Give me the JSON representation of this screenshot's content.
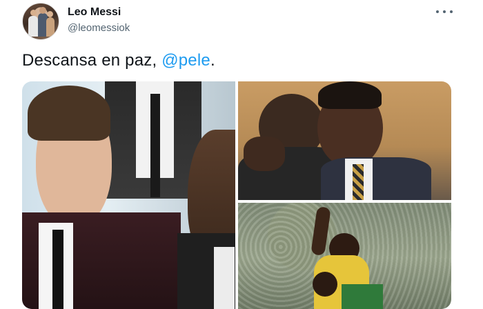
{
  "tweet": {
    "author_name": "Leo Messi",
    "author_handle": "@leomessiok",
    "text_prefix": "Descansa en paz, ",
    "mention": "@pele",
    "text_suffix": ".",
    "mention_color": "#1d9bf0"
  },
  "icons": {
    "more": "more-options-icon"
  },
  "media": {
    "count": 3,
    "images": [
      {
        "id": "left",
        "subject": "photo-messi-pele-suits"
      },
      {
        "id": "top-right",
        "subject": "photo-messi-pele-embrace"
      },
      {
        "id": "bottom-right",
        "subject": "photo-pele-celebrating"
      }
    ]
  }
}
